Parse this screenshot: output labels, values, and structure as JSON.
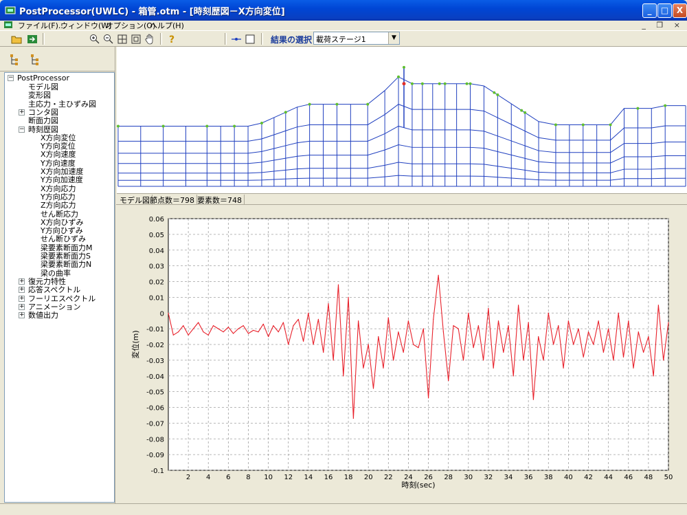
{
  "window": {
    "title": "PostProcessor(UWLC) - 箱管.otm - [時刻歴図－X方向変位]",
    "minimize": "_",
    "maximize": "□",
    "close": "X"
  },
  "menubar": {
    "items": [
      "ファイル(F)...",
      "ウィンドウ(W)",
      "オプション(O)",
      "ヘルプ(H)"
    ],
    "mdi_controls": "_ ❐ ×"
  },
  "toolbar": {
    "result_select_label": "結果の選択",
    "stage_value": "載荷ステージ1",
    "icons": [
      "open-folder-icon",
      "export-icon",
      "zoom-in-icon",
      "zoom-out-icon",
      "fit-icon",
      "frame-icon",
      "pan-hand-icon",
      "help-icon",
      "node-line-icon",
      "square-icon"
    ]
  },
  "tree": {
    "root": "PostProcessor",
    "items": [
      {
        "label": "モデル図",
        "level": 1,
        "expander": ""
      },
      {
        "label": "変形図",
        "level": 1,
        "expander": ""
      },
      {
        "label": "主応力・主ひずみ図",
        "level": 1,
        "expander": ""
      },
      {
        "label": "コンタ図",
        "level": 1,
        "expander": "+"
      },
      {
        "label": "断面力図",
        "level": 1,
        "expander": ""
      },
      {
        "label": "時刻歴図",
        "level": 1,
        "expander": "−"
      },
      {
        "label": "X方向変位",
        "level": 2,
        "expander": ""
      },
      {
        "label": "Y方向変位",
        "level": 2,
        "expander": ""
      },
      {
        "label": "X方向速度",
        "level": 2,
        "expander": ""
      },
      {
        "label": "Y方向速度",
        "level": 2,
        "expander": ""
      },
      {
        "label": "X方向加速度",
        "level": 2,
        "expander": ""
      },
      {
        "label": "Y方向加速度",
        "level": 2,
        "expander": ""
      },
      {
        "label": "X方向応力",
        "level": 2,
        "expander": ""
      },
      {
        "label": "Y方向応力",
        "level": 2,
        "expander": ""
      },
      {
        "label": "Z方向応力",
        "level": 2,
        "expander": ""
      },
      {
        "label": "せん断応力",
        "level": 2,
        "expander": ""
      },
      {
        "label": "X方向ひずみ",
        "level": 2,
        "expander": ""
      },
      {
        "label": "Y方向ひずみ",
        "level": 2,
        "expander": ""
      },
      {
        "label": "せん断ひずみ",
        "level": 2,
        "expander": ""
      },
      {
        "label": "梁要素断面力M",
        "level": 2,
        "expander": ""
      },
      {
        "label": "梁要素断面力S",
        "level": 2,
        "expander": ""
      },
      {
        "label": "梁要素断面力N",
        "level": 2,
        "expander": ""
      },
      {
        "label": "梁の曲率",
        "level": 2,
        "expander": ""
      },
      {
        "label": "復元力特性",
        "level": 1,
        "expander": "+"
      },
      {
        "label": "応答スペクトル",
        "level": 1,
        "expander": "+"
      },
      {
        "label": "フーリエスペクトル",
        "level": 1,
        "expander": "+"
      },
      {
        "label": "アニメーション",
        "level": 1,
        "expander": "+"
      },
      {
        "label": "数値出力",
        "level": 1,
        "expander": "+"
      }
    ]
  },
  "mesh_status": {
    "view": "モデル図",
    "nodes": "節点数＝798",
    "elements": "要素数＝748"
  },
  "colors": {
    "mesh_line": "#1f3fbf",
    "mesh_node": "#5fbf2f",
    "series": "#e8202a",
    "grid": "#a0a0a0"
  },
  "chart_data": {
    "type": "line",
    "xlabel": "時刻(sec)",
    "ylabel": "変位(m)",
    "xlim": [
      0,
      50
    ],
    "ylim": [
      -0.1,
      0.06
    ],
    "xticks": [
      2,
      4,
      6,
      8,
      10,
      12,
      14,
      16,
      18,
      20,
      22,
      24,
      26,
      28,
      30,
      32,
      34,
      36,
      38,
      40,
      42,
      44,
      46,
      48,
      50
    ],
    "yticks": [
      0.06,
      0.05,
      0.04,
      0.03,
      0.02,
      0.01,
      0,
      -0.01,
      -0.02,
      -0.03,
      -0.04,
      -0.05,
      -0.06,
      -0.07,
      -0.08,
      -0.09,
      -0.1
    ],
    "ytick_labels": [
      "0.06",
      "0.05",
      "0.04",
      "0.03",
      "0.02",
      "0.01",
      "0",
      "-0.01",
      "-0.02",
      "-0.03",
      "-0.04",
      "-0.05",
      "-0.06",
      "-0.07",
      "-0.08",
      "-0.09",
      "-0.1"
    ],
    "grid": true,
    "series": [
      {
        "x": [
          0,
          0.5,
          1,
          1.5,
          2,
          2.5,
          3,
          3.5,
          4,
          4.5,
          5,
          5.5,
          6,
          6.5,
          7,
          7.5,
          8,
          8.5,
          9,
          9.5,
          10,
          10.5,
          11,
          11.5,
          12,
          12.5,
          13,
          13.5,
          14,
          14.5,
          15,
          15.5,
          16,
          16.5,
          17,
          17.5,
          18,
          18.5,
          19,
          19.5,
          20,
          20.5,
          21,
          21.5,
          22,
          22.5,
          23,
          23.5,
          24,
          24.5,
          25,
          25.5,
          26,
          26.5,
          27,
          27.5,
          28,
          28.5,
          29,
          29.5,
          30,
          30.5,
          31,
          31.5,
          32,
          32.5,
          33,
          33.5,
          34,
          34.5,
          35,
          35.5,
          36,
          36.5,
          37,
          37.5,
          38,
          38.5,
          39,
          39.5,
          40,
          40.5,
          41,
          41.5,
          42,
          42.5,
          43,
          43.5,
          44,
          44.5,
          45,
          45.5,
          46,
          46.5,
          47,
          47.5,
          48,
          48.5,
          49,
          49.5,
          50
        ],
        "y": [
          0,
          -0.014,
          -0.012,
          -0.008,
          -0.014,
          -0.01,
          -0.006,
          -0.012,
          -0.014,
          -0.008,
          -0.01,
          -0.012,
          -0.009,
          -0.013,
          -0.01,
          -0.008,
          -0.013,
          -0.011,
          -0.012,
          -0.007,
          -0.015,
          -0.008,
          -0.012,
          -0.006,
          -0.02,
          -0.008,
          -0.004,
          -0.018,
          0.0,
          -0.02,
          -0.004,
          -0.025,
          0.006,
          -0.03,
          0.018,
          -0.04,
          0.01,
          -0.067,
          -0.005,
          -0.035,
          -0.02,
          -0.048,
          -0.015,
          -0.035,
          -0.003,
          -0.03,
          -0.012,
          -0.025,
          -0.005,
          -0.02,
          -0.022,
          -0.01,
          -0.054,
          -0.004,
          0.024,
          -0.012,
          -0.043,
          -0.008,
          -0.01,
          -0.03,
          0.0,
          -0.022,
          -0.008,
          -0.03,
          0.003,
          -0.035,
          -0.005,
          -0.025,
          -0.008,
          -0.04,
          0.005,
          -0.03,
          -0.006,
          -0.055,
          -0.015,
          -0.03,
          0.0,
          -0.02,
          -0.008,
          -0.035,
          -0.005,
          -0.02,
          -0.01,
          -0.028,
          -0.012,
          -0.02,
          -0.005,
          -0.025,
          -0.01,
          -0.03,
          0.0,
          -0.028,
          -0.005,
          -0.035,
          -0.012,
          -0.025,
          -0.015,
          -0.04,
          0.005,
          -0.03,
          -0.006
        ]
      }
    ]
  }
}
